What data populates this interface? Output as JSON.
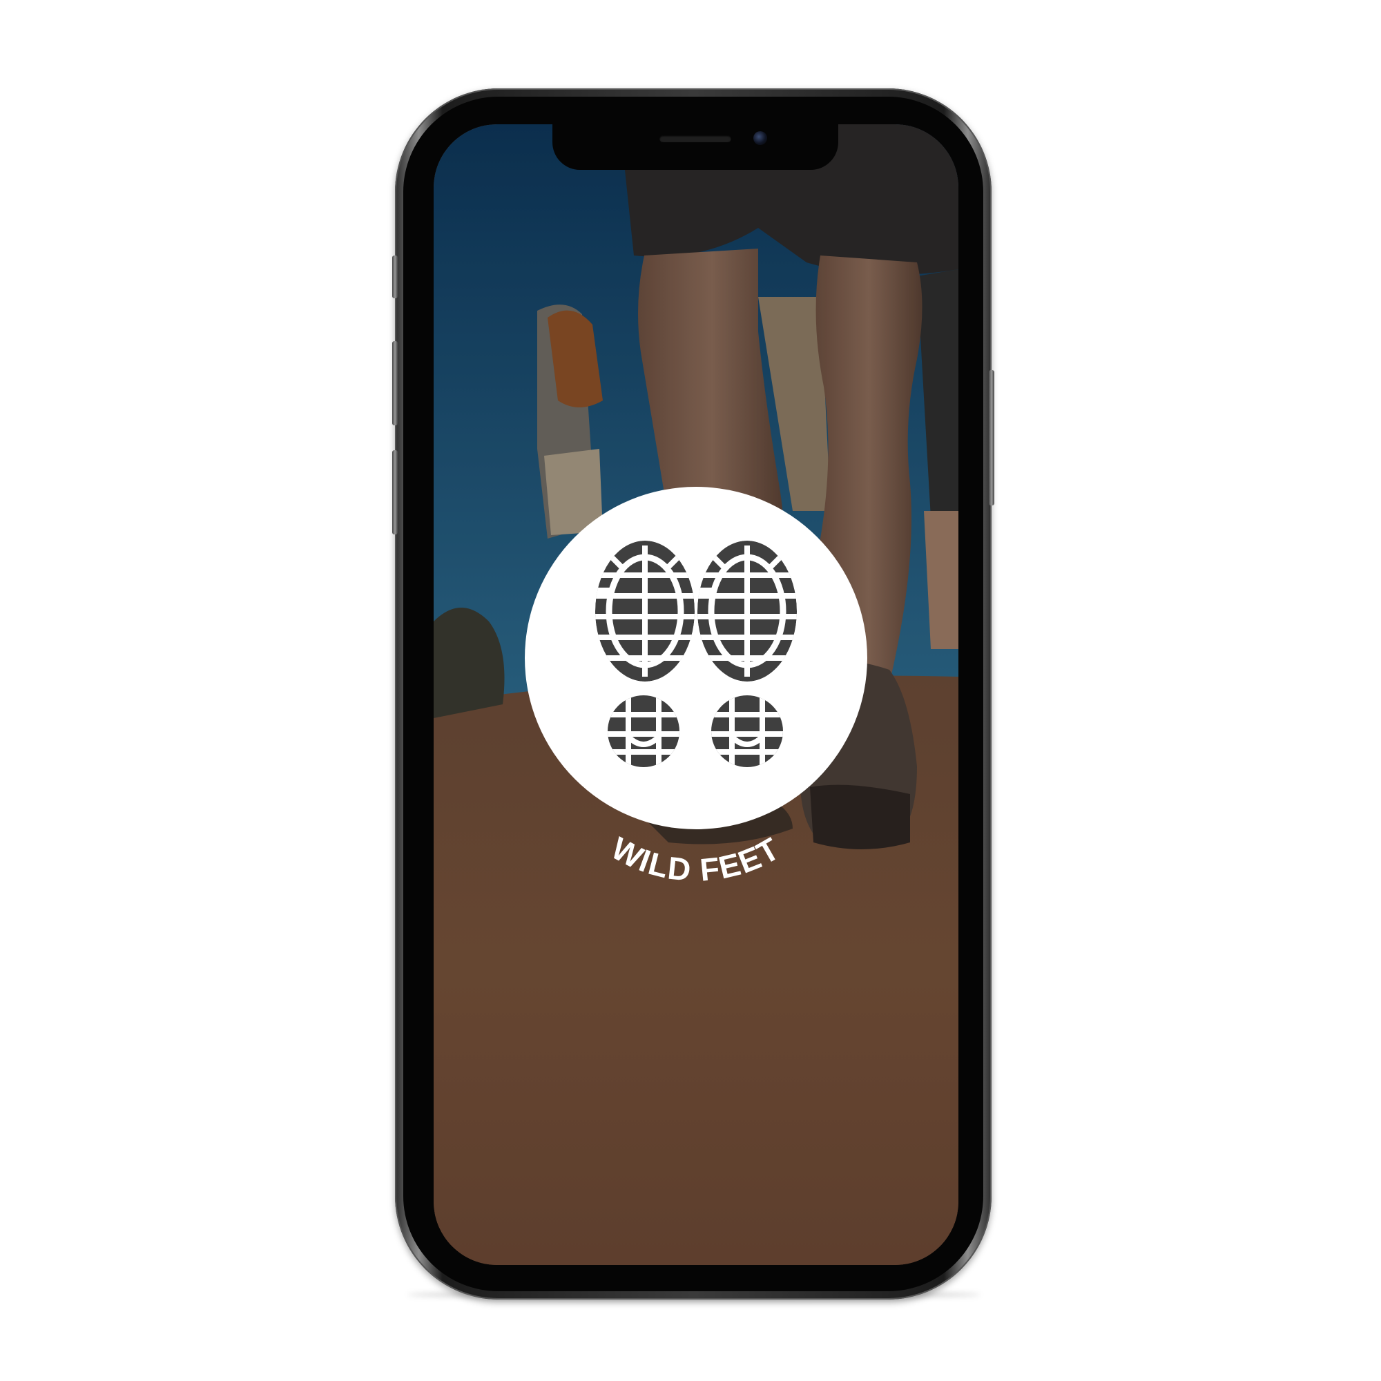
{
  "app": {
    "brand_name": "WILD FEET",
    "logo_icon": "boot-prints-icon",
    "logo_background": "#ffffff",
    "logo_foreground": "#3f3f3f",
    "brand_text_color": "#ffffff"
  },
  "device": {
    "type": "phone"
  }
}
